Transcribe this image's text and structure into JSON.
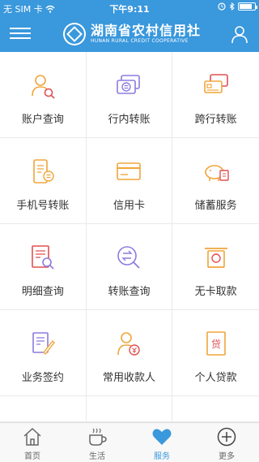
{
  "status_bar": {
    "carrier": "无 SIM 卡",
    "time": "下午9:11",
    "battery_level": 0.85
  },
  "header": {
    "logo_cn": "湖南省农村信用社",
    "logo_en": "HUNAN RURAL CREDIT COOPERATIVE",
    "menu_icon": "hamburger-menu-icon",
    "user_icon": "user-icon"
  },
  "services": [
    {
      "label": "账户查询",
      "icon": "account-search-icon"
    },
    {
      "label": "行内转账",
      "icon": "intra-bank-transfer-icon"
    },
    {
      "label": "跨行转账",
      "icon": "inter-bank-transfer-icon"
    },
    {
      "label": "手机号转账",
      "icon": "phone-transfer-icon"
    },
    {
      "label": "信用卡",
      "icon": "credit-card-icon"
    },
    {
      "label": "储蓄服务",
      "icon": "savings-piggy-icon"
    },
    {
      "label": "明细查询",
      "icon": "detail-search-icon"
    },
    {
      "label": "转账查询",
      "icon": "transfer-search-icon"
    },
    {
      "label": "无卡取款",
      "icon": "cardless-withdraw-icon"
    },
    {
      "label": "业务签约",
      "icon": "business-sign-icon"
    },
    {
      "label": "常用收款人",
      "icon": "payee-icon"
    },
    {
      "label": "个人贷款",
      "icon": "personal-loan-icon"
    }
  ],
  "tabs": [
    {
      "label": "首页",
      "icon": "home-icon",
      "active": false
    },
    {
      "label": "生活",
      "icon": "coffee-cup-icon",
      "active": false
    },
    {
      "label": "服务",
      "icon": "heart-icon",
      "active": true
    },
    {
      "label": "更多",
      "icon": "plus-circle-icon",
      "active": false
    }
  ],
  "colors": {
    "brand": "#3a98dc",
    "icon_orange": "#f0a53a",
    "icon_purple": "#8e7be0",
    "icon_red": "#e05050"
  }
}
